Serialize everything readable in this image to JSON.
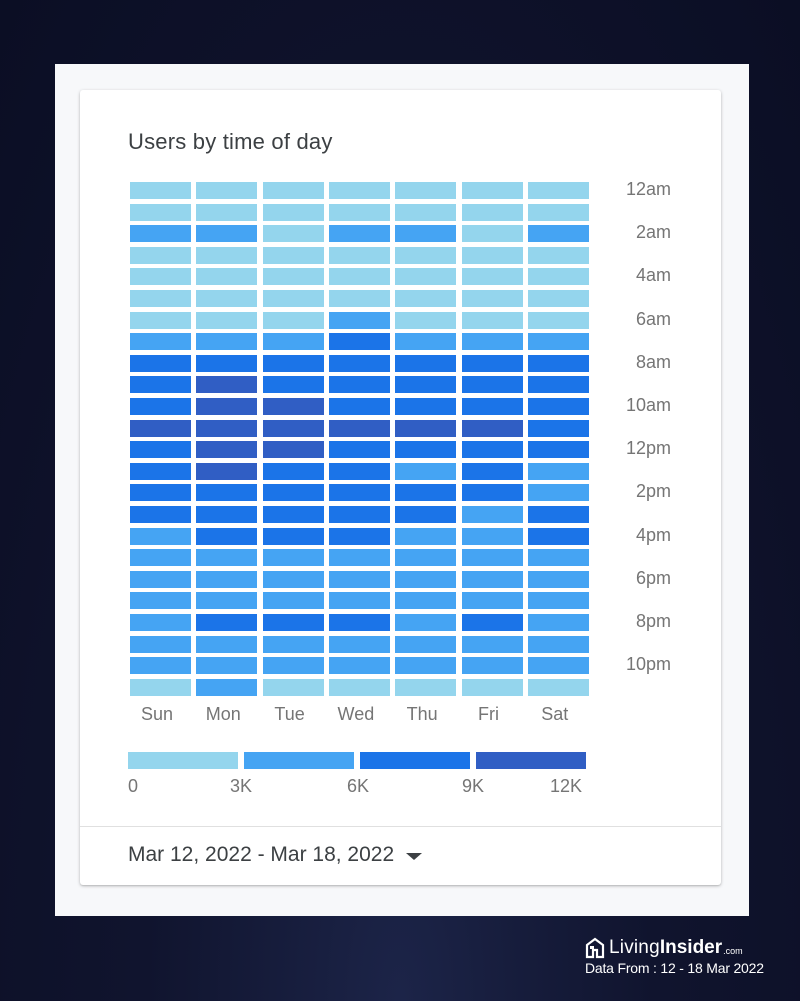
{
  "card": {
    "title": "Users by time of day",
    "date_range": "Mar 12, 2022 - Mar 18, 2022",
    "date_range_icon": "caret-down-icon"
  },
  "branding": {
    "logo_icon": "house-icon",
    "name_light": "Living",
    "name_bold": "Insider",
    "domain_suffix": ".com",
    "data_from": "Data From : 12 - 18 Mar 2022"
  },
  "colors": {
    "bin0": "#94d5ed",
    "bin1": "#45a4f3",
    "bin2": "#1b74e8",
    "bin3": "#305ec4"
  },
  "chart_data": {
    "type": "heatmap",
    "title": "Users by time of day",
    "xlabel": "",
    "ylabel": "",
    "x_categories": [
      "Sun",
      "Mon",
      "Tue",
      "Wed",
      "Thu",
      "Fri",
      "Sat"
    ],
    "y_categories": [
      "12am",
      "1am",
      "2am",
      "3am",
      "4am",
      "5am",
      "6am",
      "7am",
      "8am",
      "9am",
      "10am",
      "11am",
      "12pm",
      "1pm",
      "2pm",
      "3pm",
      "4pm",
      "5pm",
      "6pm",
      "7pm",
      "8pm",
      "9pm",
      "10pm",
      "11pm"
    ],
    "y_tick_labels": [
      "12am",
      "2am",
      "4am",
      "6am",
      "8am",
      "10am",
      "12pm",
      "2pm",
      "4pm",
      "6pm",
      "8pm",
      "10pm"
    ],
    "value_encoding": "bin index (0: 0-3K, 1: 3K-6K, 2: 6K-9K, 3: 9K-12K users)",
    "legend": {
      "position": "bottom",
      "bins": [
        {
          "range": [
            0,
            3000
          ]
        },
        {
          "range": [
            3000,
            6000
          ]
        },
        {
          "range": [
            6000,
            9000
          ]
        },
        {
          "range": [
            9000,
            12000
          ]
        }
      ],
      "tick_labels": [
        "0",
        "3K",
        "6K",
        "9K",
        "12K"
      ]
    },
    "values": [
      [
        0,
        0,
        0,
        0,
        0,
        0,
        0
      ],
      [
        0,
        0,
        0,
        0,
        0,
        0,
        0
      ],
      [
        1,
        1,
        0,
        1,
        1,
        0,
        1
      ],
      [
        0,
        0,
        0,
        0,
        0,
        0,
        0
      ],
      [
        0,
        0,
        0,
        0,
        0,
        0,
        0
      ],
      [
        0,
        0,
        0,
        0,
        0,
        0,
        0
      ],
      [
        0,
        0,
        0,
        1,
        0,
        0,
        0
      ],
      [
        1,
        1,
        1,
        2,
        1,
        1,
        1
      ],
      [
        2,
        2,
        2,
        2,
        2,
        2,
        2
      ],
      [
        2,
        3,
        2,
        2,
        2,
        2,
        2
      ],
      [
        2,
        3,
        3,
        2,
        2,
        2,
        2
      ],
      [
        3,
        3,
        3,
        3,
        3,
        3,
        2
      ],
      [
        2,
        3,
        3,
        2,
        2,
        2,
        2
      ],
      [
        2,
        3,
        2,
        2,
        1,
        2,
        1
      ],
      [
        2,
        2,
        2,
        2,
        2,
        2,
        1
      ],
      [
        2,
        2,
        2,
        2,
        2,
        1,
        2
      ],
      [
        1,
        2,
        2,
        2,
        1,
        1,
        2
      ],
      [
        1,
        1,
        1,
        1,
        1,
        1,
        1
      ],
      [
        1,
        1,
        1,
        1,
        1,
        1,
        1
      ],
      [
        1,
        1,
        1,
        1,
        1,
        1,
        1
      ],
      [
        1,
        2,
        2,
        2,
        1,
        2,
        1
      ],
      [
        1,
        1,
        1,
        1,
        1,
        1,
        1
      ],
      [
        1,
        1,
        1,
        1,
        1,
        1,
        1
      ],
      [
        0,
        1,
        0,
        0,
        0,
        0,
        0
      ]
    ]
  }
}
